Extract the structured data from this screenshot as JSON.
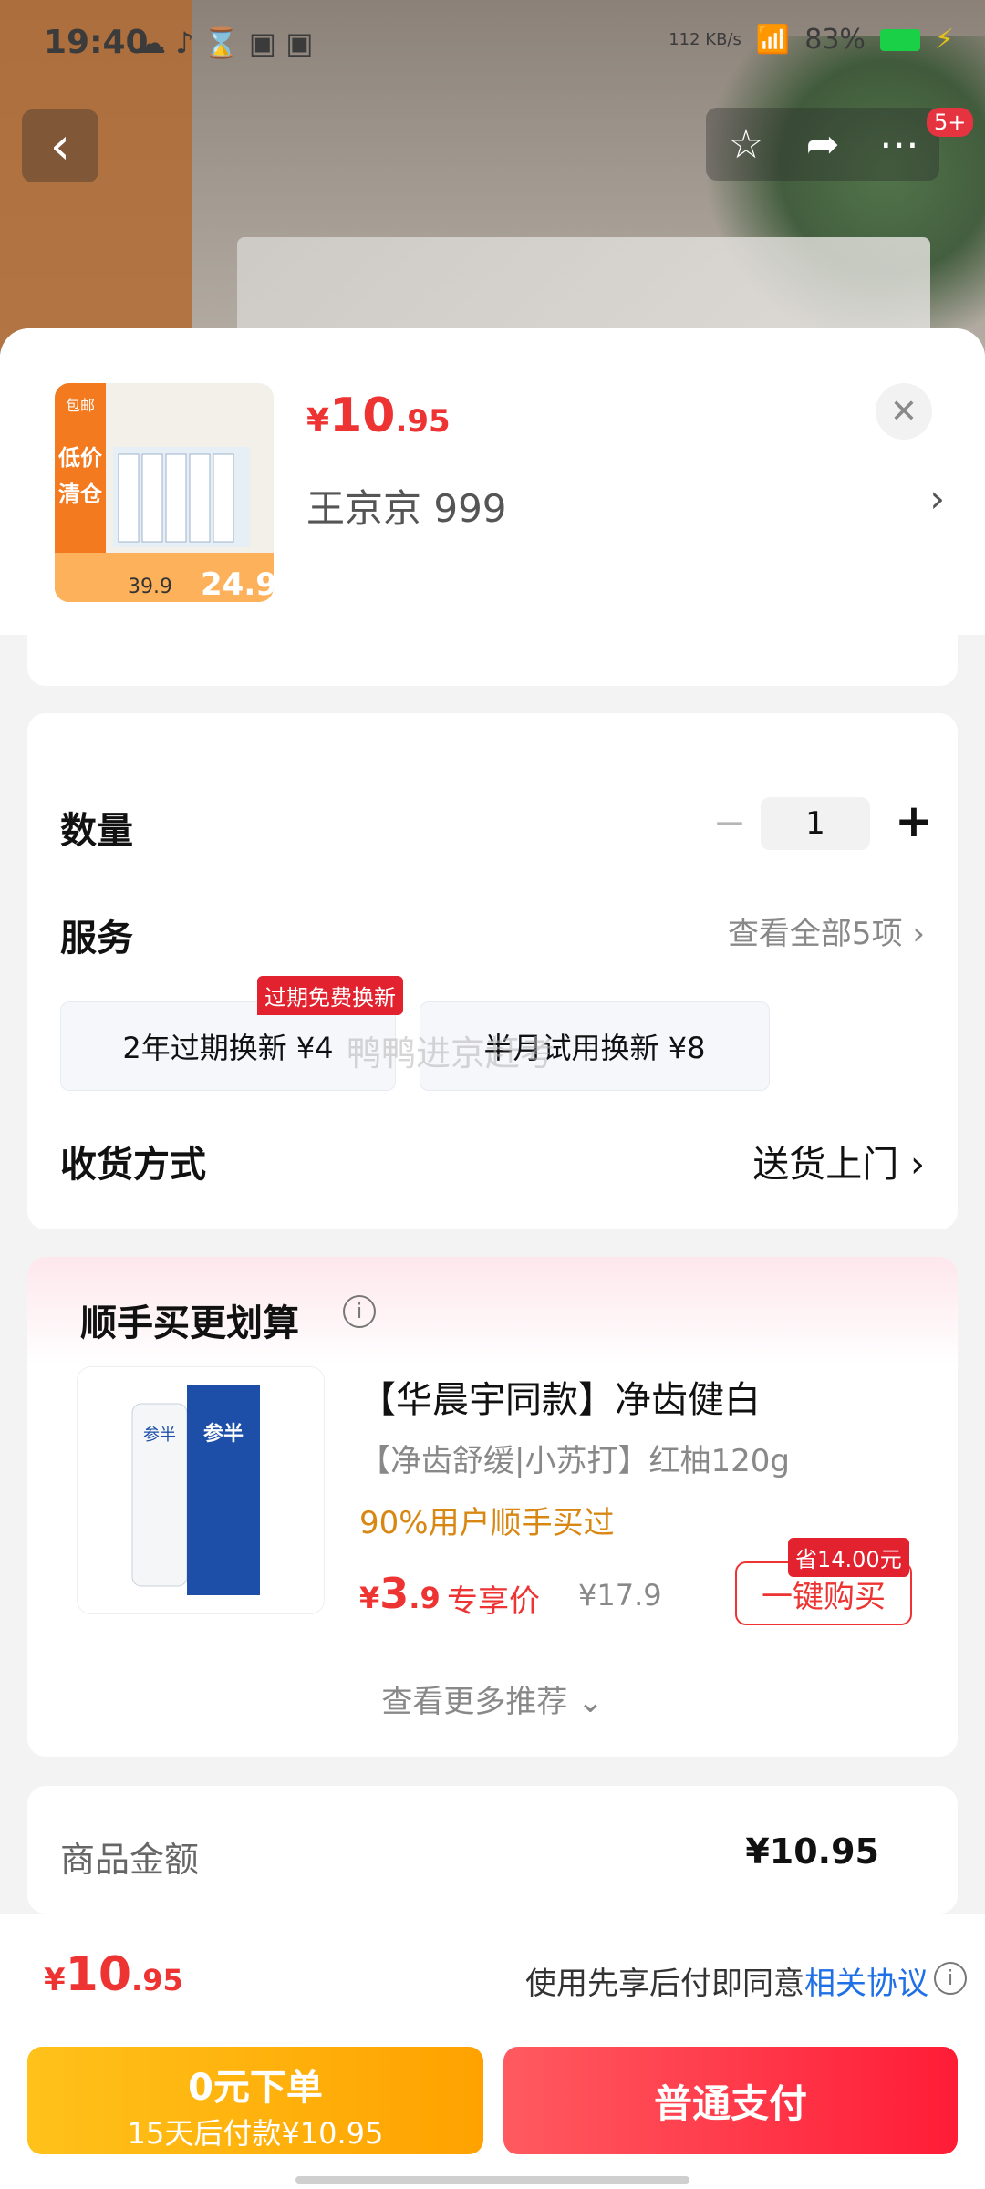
{
  "status_bar": {
    "time": "19:40",
    "battery": "83%",
    "speed": "112 KB/s"
  },
  "nav": {
    "back_icon": "chevron-left-icon",
    "star_icon": "star-icon",
    "share_icon": "share-icon",
    "more_icon": "more-icon",
    "badge": "5+"
  },
  "product": {
    "price_symbol": "¥",
    "price_int": "10",
    "price_dec": ".95",
    "spec": "王京京   999",
    "image_texts": {
      "badge": "包邮",
      "title": "低价清仓",
      "was": "39.9",
      "now": "24.9"
    }
  },
  "quantity": {
    "label": "数量",
    "value": "1"
  },
  "service": {
    "label": "服务",
    "see_all": "查看全部5项",
    "options": [
      {
        "label": "2年过期换新  ¥4",
        "tag": "过期免费换新"
      },
      {
        "label": "半月试用换新  ¥8"
      }
    ],
    "watermark": "鸭鸭进京赶考"
  },
  "delivery": {
    "label": "收货方式",
    "value": "送货上门"
  },
  "recommend": {
    "title": "顺手买更划算",
    "item": {
      "title": "【华晨宇同款】净齿健白",
      "subtitle": "【净齿舒缓|小苏打】红柚120g",
      "social": "90%用户顺手买过",
      "price_symbol": "¥",
      "price_int": "3",
      "price_dec": ".9",
      "special_label": "专享价",
      "original_price": "¥17.9",
      "buy_label": "一键购买",
      "save_tag": "省14.00元"
    },
    "see_more": "查看更多推荐"
  },
  "amount": {
    "label": "商品金额",
    "value": "¥10.95"
  },
  "summary": {
    "price_symbol": "¥",
    "price_int": "10",
    "price_dec": ".95",
    "note_prefix": "使用先享后付即同意",
    "note_link": "相关协议"
  },
  "actions": {
    "pay_later_line1": "0元下单",
    "pay_later_line2": "15天后付款¥10.95",
    "pay_now": "普通支付"
  },
  "colors": {
    "accent_red": "#ee3333",
    "link_blue": "#1f6fe6",
    "gold": "#ffb30f"
  }
}
